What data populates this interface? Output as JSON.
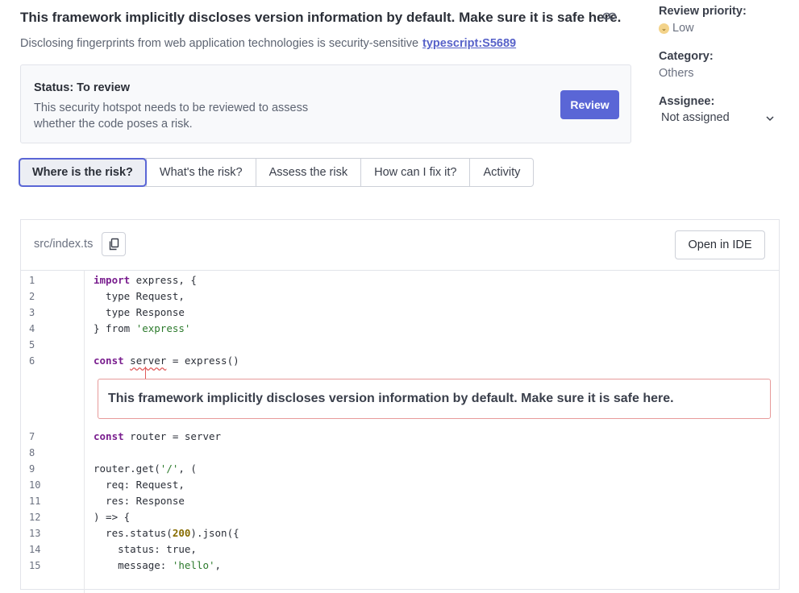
{
  "hotspot": {
    "title": "This framework implicitly discloses version information by default. Make sure it is safe here.",
    "subtitle": "Disclosing fingerprints from web application technologies is security-sensitive",
    "rule_link": "typescript:S5689"
  },
  "status": {
    "title": "Status: To review",
    "description": "This security hotspot needs to be reviewed to assess whether the code poses a risk.",
    "review_button": "Review"
  },
  "sidebar": {
    "priority_label": "Review priority:",
    "priority_value": "Low",
    "category_label": "Category:",
    "category_value": "Others",
    "assignee_label": "Assignee:",
    "assignee_value": "Not assigned"
  },
  "tabs": [
    {
      "label": "Where is the risk?",
      "active": true
    },
    {
      "label": "What's the risk?"
    },
    {
      "label": "Assess the risk"
    },
    {
      "label": "How can I fix it?"
    },
    {
      "label": "Activity"
    }
  ],
  "code": {
    "file_path": "src/index.ts",
    "open_ide_button": "Open in IDE",
    "issue_message": "This framework implicitly discloses version information by default. Make sure it is safe here.",
    "line_numbers": [
      "1",
      "2",
      "3",
      "4",
      "5",
      "6",
      "7",
      "8",
      "9",
      "10",
      "11",
      "12",
      "13",
      "14",
      "15"
    ]
  },
  "colors": {
    "accent": "#5a66d6",
    "issue_border": "#e79a9a",
    "priority_low": "#f3d38a"
  }
}
